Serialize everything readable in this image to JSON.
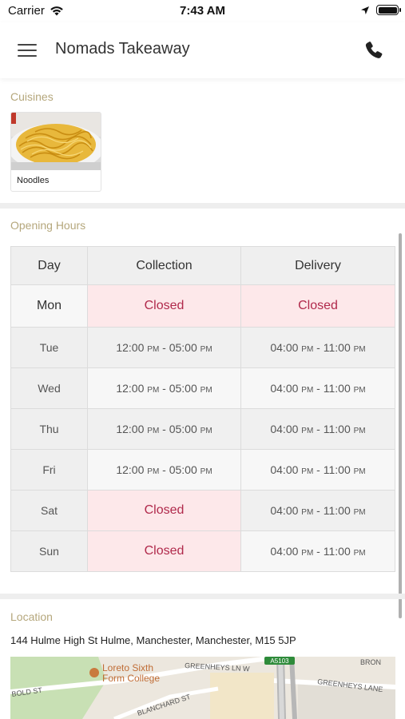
{
  "status_bar": {
    "carrier": "Carrier",
    "time": "7:43 AM"
  },
  "header": {
    "title": "Nomads Takeaway",
    "icons": [
      "menu-icon",
      "phone-icon"
    ]
  },
  "cuisines": {
    "title": "Cuisines",
    "items": [
      {
        "label": "Noodles"
      }
    ]
  },
  "opening_hours": {
    "title": "Opening Hours",
    "columns": [
      "Day",
      "Collection",
      "Delivery"
    ],
    "rows": [
      {
        "day": "Mon",
        "collection": "Closed",
        "delivery": "Closed",
        "collection_closed": true,
        "delivery_closed": true
      },
      {
        "day": "Tue",
        "collection": "12:00 PM - 05:00 PM",
        "delivery": "04:00 PM - 11:00 PM",
        "collection_closed": false,
        "delivery_closed": false
      },
      {
        "day": "Wed",
        "collection": "12:00 PM - 05:00 PM",
        "delivery": "04:00 PM - 11:00 PM",
        "collection_closed": false,
        "delivery_closed": false
      },
      {
        "day": "Thu",
        "collection": "12:00 PM - 05:00 PM",
        "delivery": "04:00 PM - 11:00 PM",
        "collection_closed": false,
        "delivery_closed": false
      },
      {
        "day": "Fri",
        "collection": "12:00 PM - 05:00 PM",
        "delivery": "04:00 PM - 11:00 PM",
        "collection_closed": false,
        "delivery_closed": false
      },
      {
        "day": "Sat",
        "collection": "Closed",
        "delivery": "04:00 PM - 11:00 PM",
        "collection_closed": true,
        "delivery_closed": false
      },
      {
        "day": "Sun",
        "collection": "Closed",
        "delivery": "04:00 PM - 11:00 PM",
        "collection_closed": true,
        "delivery_closed": false
      }
    ]
  },
  "location": {
    "title": "Location",
    "address": "144 Hulme High St Hulme, Manchester, Manchester, M15 5JP",
    "map_labels": {
      "poi_line1": "Loreto Sixth",
      "poi_line2": "Form College",
      "street1": "GREENHEYS LN W",
      "street2": "GREENHEYS LANE",
      "street3": "BOLD ST",
      "street4": "BLANCHARD ST",
      "street5": "BRON",
      "road_shield": "A5103"
    }
  },
  "colors": {
    "section_title": "#b5a77c",
    "closed_text": "#b0294b",
    "closed_bg": "#fde8ea"
  }
}
